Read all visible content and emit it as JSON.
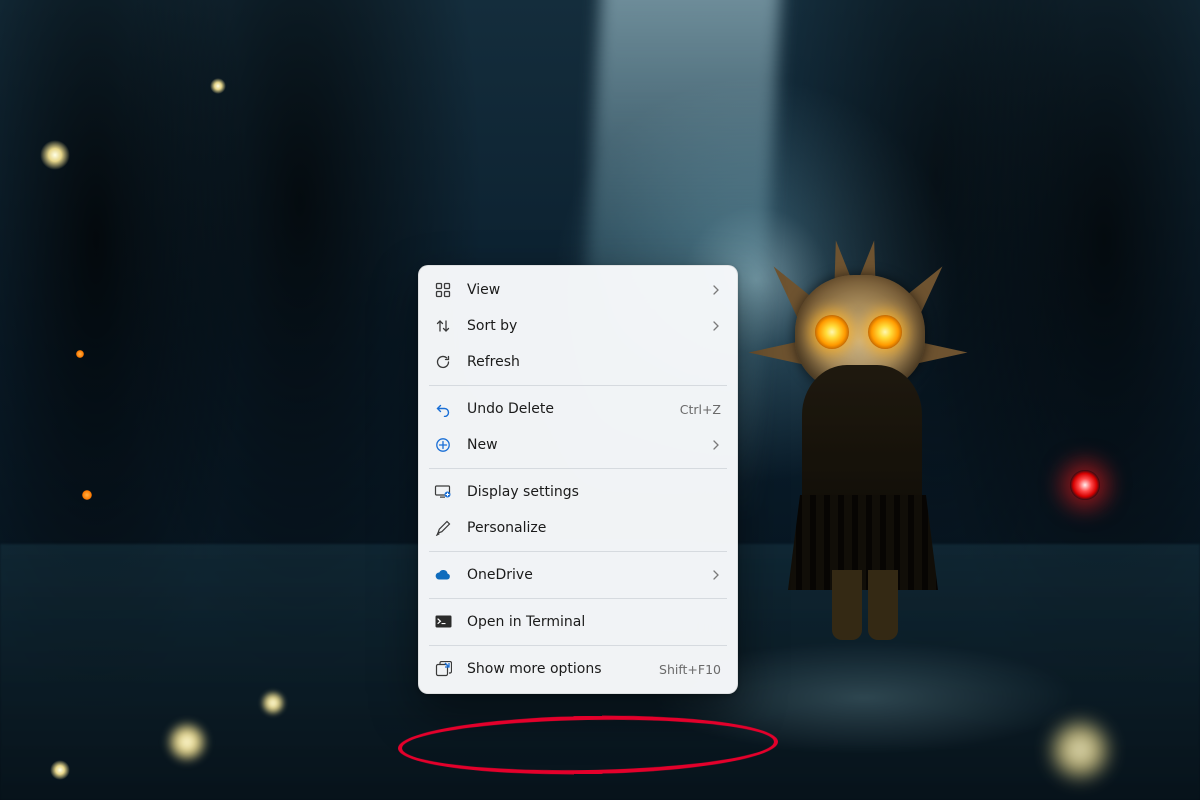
{
  "context_menu": {
    "groups": [
      [
        {
          "id": "view",
          "icon": "grid-icon",
          "label": "View",
          "submenu": true
        },
        {
          "id": "sort",
          "icon": "sort-icon",
          "label": "Sort by",
          "submenu": true
        },
        {
          "id": "refresh",
          "icon": "refresh-icon",
          "label": "Refresh"
        }
      ],
      [
        {
          "id": "undo",
          "icon": "undo-icon",
          "label": "Undo Delete",
          "accelerator": "Ctrl+Z"
        },
        {
          "id": "new",
          "icon": "new-icon",
          "label": "New",
          "submenu": true
        }
      ],
      [
        {
          "id": "display",
          "icon": "display-settings-icon",
          "label": "Display settings"
        },
        {
          "id": "personalize",
          "icon": "personalize-icon",
          "label": "Personalize"
        }
      ],
      [
        {
          "id": "onedrive",
          "icon": "onedrive-icon",
          "label": "OneDrive",
          "submenu": true
        }
      ],
      [
        {
          "id": "terminal",
          "icon": "terminal-icon",
          "label": "Open in Terminal"
        }
      ],
      [
        {
          "id": "more",
          "icon": "more-options-icon",
          "label": "Show more options",
          "accelerator": "Shift+F10"
        }
      ]
    ]
  },
  "annotation": {
    "highlights_item": "more",
    "color": "#e4002b"
  },
  "wallpaper_theme": "dark-fantasy-forest-masked-figure"
}
